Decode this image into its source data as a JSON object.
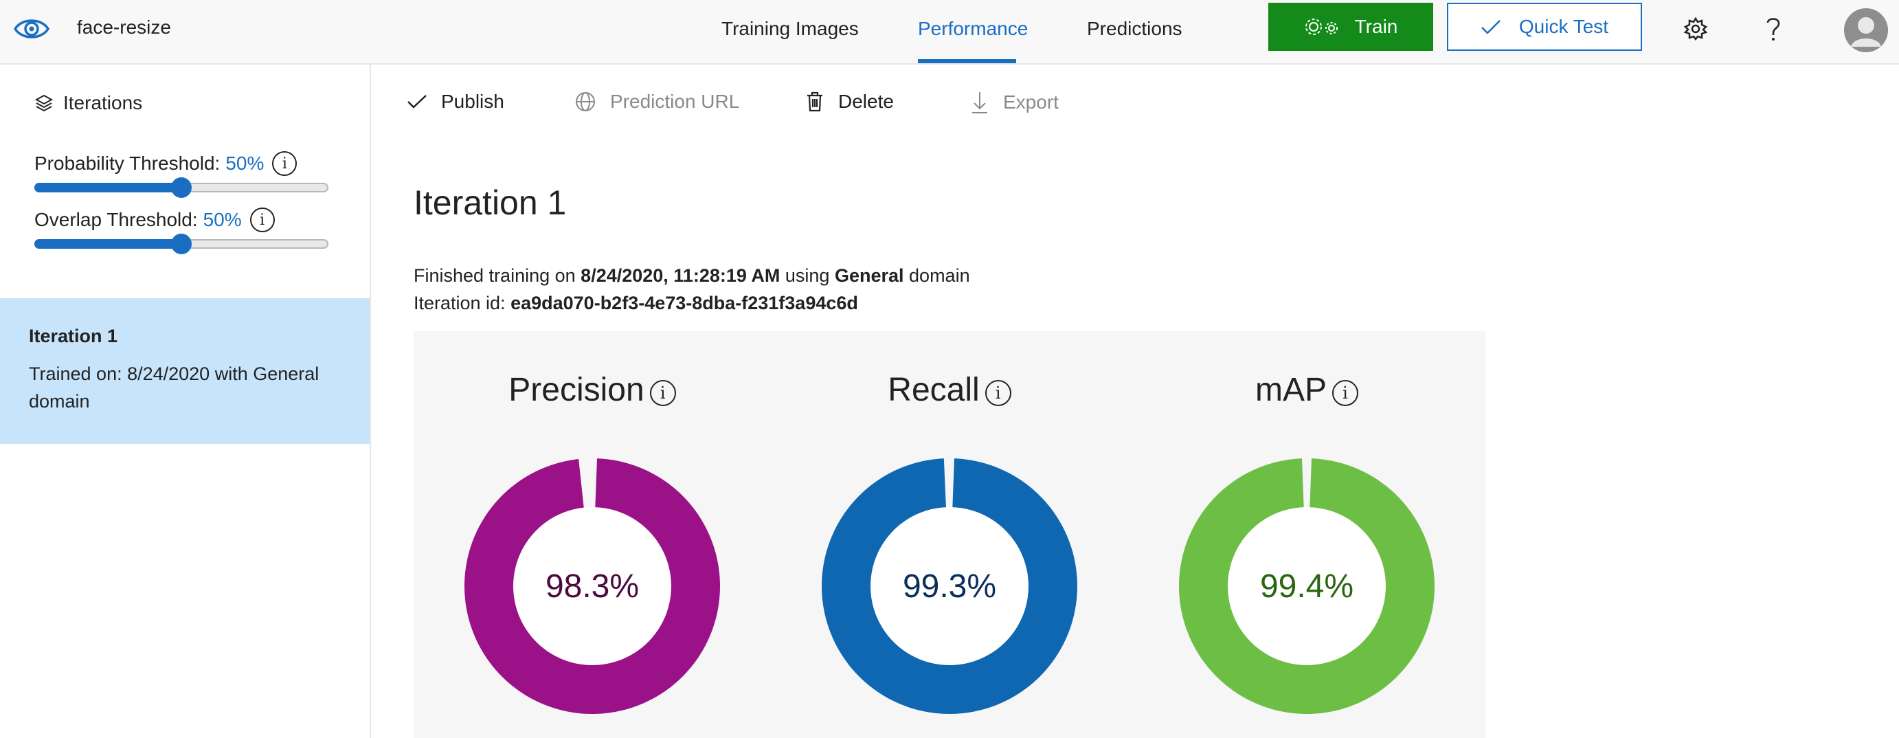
{
  "app": {
    "project_name": "face-resize"
  },
  "nav": {
    "tabs": [
      {
        "label": "Training Images"
      },
      {
        "label": "Performance",
        "active": true
      },
      {
        "label": "Predictions"
      }
    ],
    "train_label": "Train",
    "quick_test_label": "Quick Test",
    "icons": [
      "eye-logo-icon",
      "gears-icon",
      "check-icon",
      "settings-icon",
      "help-icon",
      "user-avatar-icon"
    ]
  },
  "sidebar": {
    "iterations_label": "Iterations",
    "probability": {
      "label": "Probability Threshold:",
      "value": "50%",
      "level": 0.5
    },
    "overlap": {
      "label": "Overlap Threshold:",
      "value": "50%",
      "level": 0.5
    },
    "info_glyph": "i",
    "iteration_item": {
      "title": "Iteration 1",
      "subtitle": "Trained on: 8/24/2020 with General domain"
    }
  },
  "toolbar": {
    "publish": "Publish",
    "prediction_url": "Prediction URL",
    "delete": "Delete",
    "export": "Export"
  },
  "main": {
    "iteration_title": "Iteration 1",
    "finished_prefix": "Finished training on",
    "finished_date": "8/24/2020, 11:28:19 AM",
    "finished_using": "using",
    "domain": "General",
    "domain_suffix": "domain",
    "iteration_id_label": "Iteration id:",
    "iteration_id": "ea9da070-b2f3-4e73-8dba-f231f3a94c6d"
  },
  "metrics": [
    {
      "name": "Precision",
      "value_text": "98.3%",
      "value": 0.983,
      "color": "#9b1187",
      "text_color": "#4b0a40"
    },
    {
      "name": "Recall",
      "value_text": "99.3%",
      "value": 0.993,
      "color": "#0f66b1",
      "text_color": "#0a2f5c"
    },
    {
      "name": "mAP",
      "value_text": "99.4%",
      "value": 0.994,
      "color": "#6dbe45",
      "text_color": "#2a6610"
    }
  ]
}
